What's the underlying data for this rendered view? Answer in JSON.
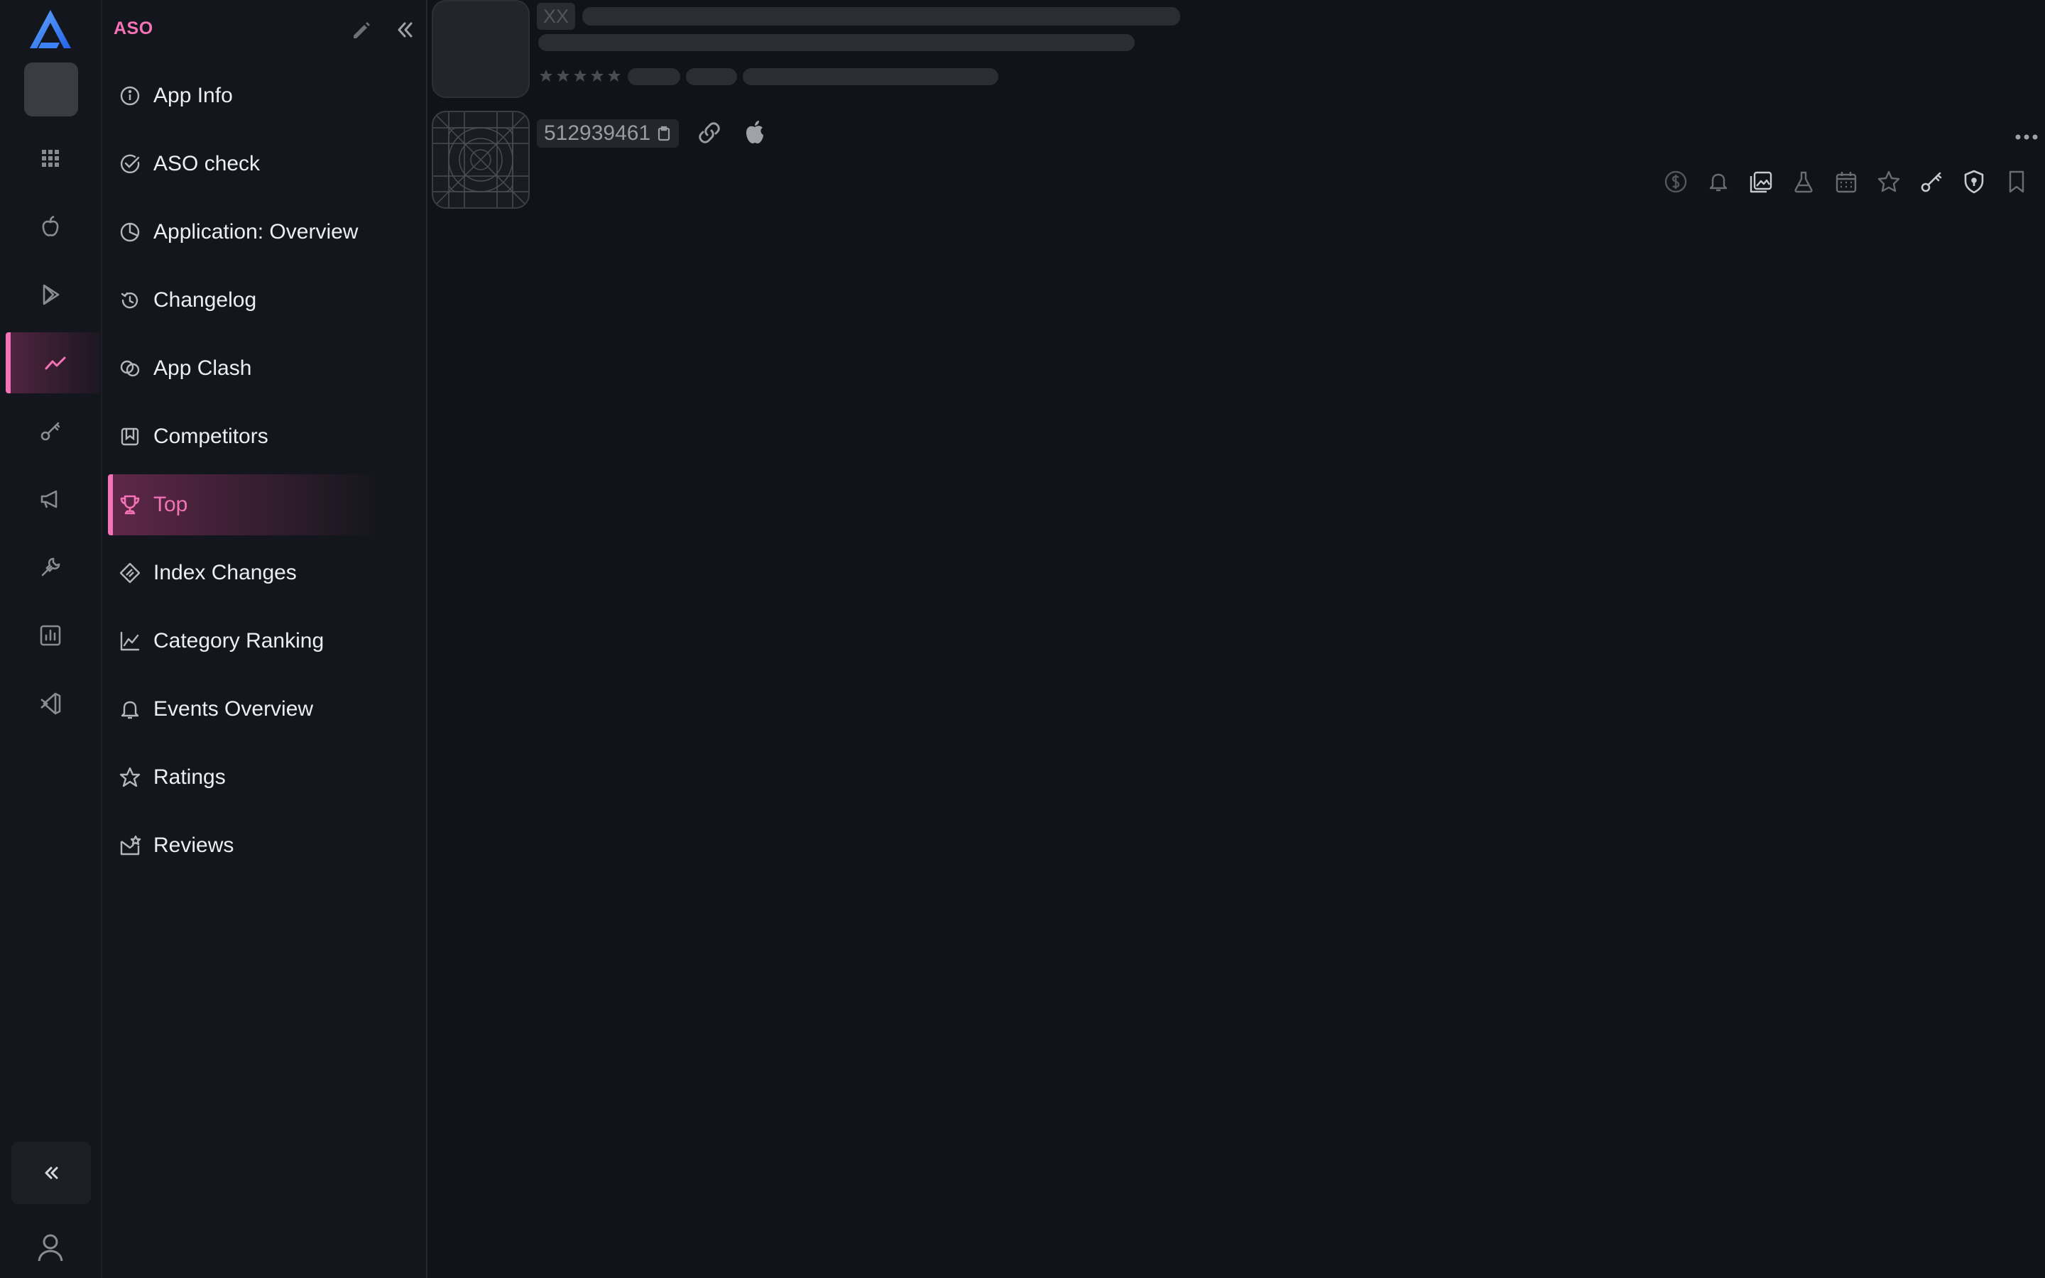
{
  "rail": {
    "items": [
      {
        "name": "apps-grid-icon",
        "active": false
      },
      {
        "name": "apple-store-icon",
        "active": false
      },
      {
        "name": "google-play-icon",
        "active": false
      },
      {
        "name": "trend-chart-icon",
        "active": true
      },
      {
        "name": "key-icon",
        "active": false
      },
      {
        "name": "megaphone-icon",
        "active": false
      },
      {
        "name": "tools-icon",
        "active": false
      },
      {
        "name": "bar-chart-icon",
        "active": false
      },
      {
        "name": "vscode-icon",
        "active": false
      }
    ],
    "collapse_icon": "double-chevron-left-icon",
    "user_icon": "user-icon"
  },
  "sidebar": {
    "section_title": "ASO",
    "items": [
      {
        "label": "App Info",
        "icon": "info-circle-icon",
        "active": false
      },
      {
        "label": "ASO check",
        "icon": "check-circle-icon",
        "active": false
      },
      {
        "label": "Application: Overview",
        "icon": "pie-chart-icon",
        "active": false
      },
      {
        "label": "Changelog",
        "icon": "history-icon",
        "active": false
      },
      {
        "label": "App Clash",
        "icon": "clash-icon",
        "active": false
      },
      {
        "label": "Competitors",
        "icon": "competitors-icon",
        "active": false
      },
      {
        "label": "Top",
        "icon": "trophy-icon",
        "active": true
      },
      {
        "label": "Index Changes",
        "icon": "index-changes-icon",
        "active": false
      },
      {
        "label": "Category Ranking",
        "icon": "line-chart-icon",
        "active": false
      },
      {
        "label": "Events Overview",
        "icon": "bell-icon",
        "active": false
      },
      {
        "label": "Ratings",
        "icon": "star-icon",
        "active": false
      },
      {
        "label": "Reviews",
        "icon": "reviews-icon",
        "active": false
      }
    ]
  },
  "header": {
    "badge": "XX",
    "app_id": "512939461",
    "rating_stars": 5
  },
  "toolbar": {
    "icons": [
      "dollar-icon",
      "bell-icon",
      "images-icon",
      "flask-icon",
      "calendar-icon",
      "star-icon",
      "key-icon",
      "shield-icon",
      "bookmark-icon"
    ]
  },
  "colors": {
    "background": "#12131a",
    "panel": "#14161d",
    "accent": "#f472b6",
    "logo": "#3b82f6",
    "muted_icon": "#8a8c94"
  }
}
